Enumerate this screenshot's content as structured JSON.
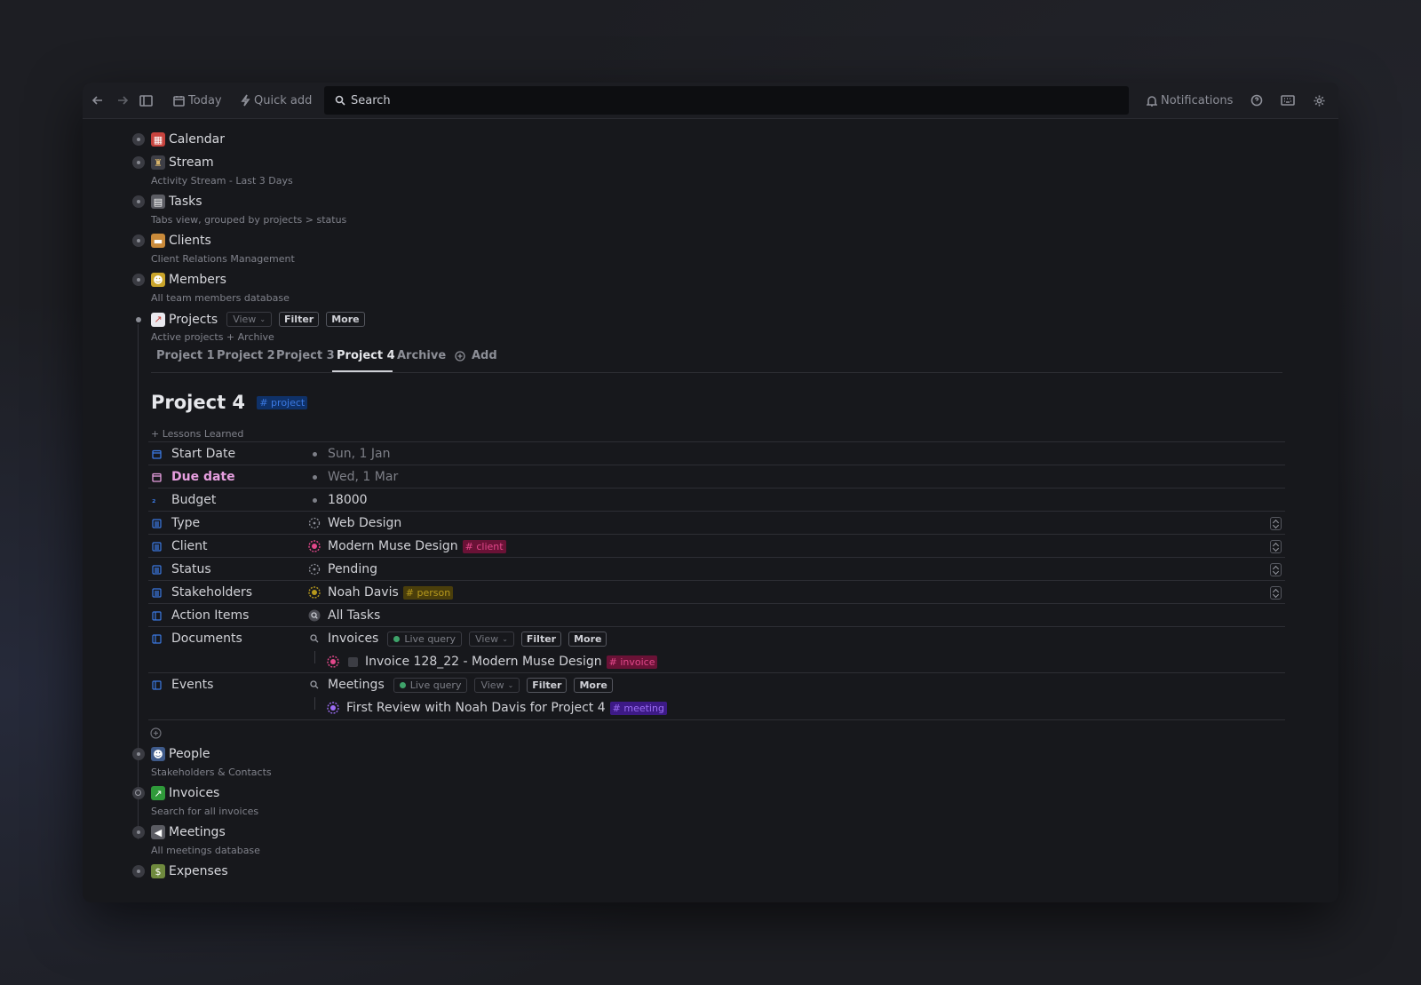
{
  "toolbar": {
    "today": "Today",
    "quick_add": "Quick add",
    "search": "Search",
    "notifications": "Notifications"
  },
  "sidebar": [
    {
      "emoji": "calendar-emoji",
      "label": "Calendar",
      "sub": ""
    },
    {
      "emoji": "stream-emoji",
      "label": "Stream",
      "sub": "Activity Stream - Last 3 Days"
    },
    {
      "emoji": "clipboard-emoji",
      "label": "Tasks",
      "sub": "Tabs view,  grouped by projects > status"
    },
    {
      "emoji": "folder-emoji",
      "label": "Clients",
      "sub": "Client Relations Management"
    },
    {
      "emoji": "people-emoji",
      "label": "Members",
      "sub": "All team members database"
    }
  ],
  "projects": {
    "label": "Projects",
    "view": "View",
    "filter": "Filter",
    "more": "More",
    "sub": "Active projects + Archive",
    "tabs": [
      "Project 1",
      "Project 2",
      "Project 3",
      "Project 4",
      "Archive"
    ],
    "add": "Add"
  },
  "page": {
    "title": "Project 4",
    "tag": "# project",
    "lessons": "Lessons Learned",
    "props": {
      "start_date": {
        "name": "Start Date",
        "value": "Sun, 1 Jan"
      },
      "due_date": {
        "name": "Due date",
        "value": "Wed, 1 Mar"
      },
      "budget": {
        "name": "Budget",
        "value": "18000"
      },
      "type": {
        "name": "Type",
        "value": "Web Design"
      },
      "client": {
        "name": "Client",
        "value": "Modern Muse Design",
        "tag": "# client"
      },
      "status": {
        "name": "Status",
        "value": "Pending"
      },
      "stakeholders": {
        "name": "Stakeholders",
        "value": "Noah Davis",
        "tag": "# person"
      },
      "action_items": {
        "name": "Action Items",
        "value": "All Tasks"
      },
      "documents": {
        "name": "Documents",
        "query": "Invoices",
        "live": "Live query",
        "view": "View",
        "filter": "Filter",
        "more": "More",
        "item": "Invoice 128_22 - Modern Muse Design",
        "item_tag": "# invoice"
      },
      "events": {
        "name": "Events",
        "query": "Meetings",
        "live": "Live query",
        "view": "View",
        "filter": "Filter",
        "more": "More",
        "item": "First Review with Noah Davis for Project 4",
        "item_tag": "# meeting"
      }
    }
  },
  "sidebar_bottom": [
    {
      "emoji": "people-emoji",
      "label": "People",
      "sub": "Stakeholders & Contacts"
    },
    {
      "emoji": "chart-emoji",
      "label": "Invoices",
      "sub": "Search for all invoices"
    },
    {
      "emoji": "megaphone-emoji",
      "label": "Meetings",
      "sub": "All meetings database"
    },
    {
      "emoji": "money-emoji",
      "label": "Expenses",
      "sub": ""
    }
  ],
  "colors": {
    "accent_blue": "#3b79e2",
    "due_pink": "#e79fe0",
    "client_pink": "#e2488a",
    "person_yellow": "#b7991d",
    "meeting_purple": "#9b6cf3"
  }
}
